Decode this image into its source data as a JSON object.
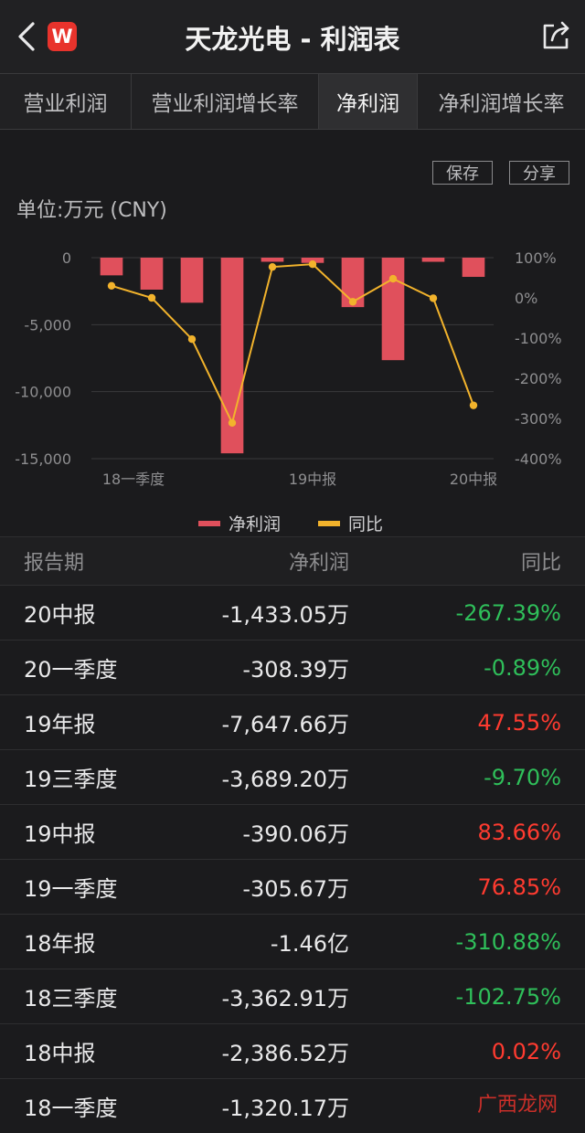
{
  "header": {
    "title": "天龙光电 - 利润表",
    "logo_text": "W",
    "brand_color": "#e8332c"
  },
  "tabs": [
    {
      "label": "营业利润",
      "active": false
    },
    {
      "label": "营业利润增长率",
      "active": false
    },
    {
      "label": "净利润",
      "active": true
    },
    {
      "label": "净利润增长率",
      "active": false
    }
  ],
  "actions": {
    "save": "保存",
    "share": "分享"
  },
  "unit_label": "单位:万元 (CNY)",
  "chart_data": {
    "type": "bar",
    "categories": [
      "18一季度",
      "18中报",
      "18三季度",
      "18年报",
      "19一季度",
      "19中报",
      "19三季度",
      "19年报",
      "20一季度",
      "20中报"
    ],
    "x_tick_labels": [
      "18一季度",
      "19中报",
      "20中报"
    ],
    "series": [
      {
        "name": "净利润",
        "type": "bar",
        "axis": "left",
        "color": "#e0505c",
        "values": [
          -1320.17,
          -2386.52,
          -3362.91,
          -14600,
          -305.67,
          -390.06,
          -3689.2,
          -7647.66,
          -308.39,
          -1433.05
        ]
      },
      {
        "name": "同比",
        "type": "line",
        "axis": "right",
        "color": "#f2b32c",
        "values": [
          30,
          0.02,
          -102.75,
          -310.88,
          76.85,
          83.66,
          -9.7,
          47.55,
          -0.89,
          -267.39
        ]
      }
    ],
    "left_axis": {
      "ticks": [
        "0",
        "-5,000",
        "-10,000",
        "-15,000"
      ],
      "ylim": [
        -15000,
        0
      ]
    },
    "right_axis": {
      "ticks": [
        "100%",
        "0%",
        "-100%",
        "-200%",
        "-300%",
        "-400%"
      ],
      "ylim": [
        -400,
        100
      ]
    },
    "legend_position": "bottom"
  },
  "table": {
    "headers": [
      "报告期",
      "净利润",
      "同比"
    ],
    "rows": [
      {
        "period": "20中报",
        "profit": "-1,433.05万",
        "yoy": "-267.39%",
        "trend": "neg"
      },
      {
        "period": "20一季度",
        "profit": "-308.39万",
        "yoy": "-0.89%",
        "trend": "neg"
      },
      {
        "period": "19年报",
        "profit": "-7,647.66万",
        "yoy": "47.55%",
        "trend": "pos"
      },
      {
        "period": "19三季度",
        "profit": "-3,689.20万",
        "yoy": "-9.70%",
        "trend": "neg"
      },
      {
        "period": "19中报",
        "profit": "-390.06万",
        "yoy": "83.66%",
        "trend": "pos"
      },
      {
        "period": "19一季度",
        "profit": "-305.67万",
        "yoy": "76.85%",
        "trend": "pos"
      },
      {
        "period": "18年报",
        "profit": "-1.46亿",
        "yoy": "-310.88%",
        "trend": "neg"
      },
      {
        "period": "18三季度",
        "profit": "-3,362.91万",
        "yoy": "-102.75%",
        "trend": "neg"
      },
      {
        "period": "18中报",
        "profit": "-2,386.52万",
        "yoy": "0.02%",
        "trend": "pos"
      },
      {
        "period": "18一季度",
        "profit": "-1,320.17万",
        "yoy": "",
        "trend": "pos"
      }
    ]
  },
  "watermark": "广西龙网"
}
